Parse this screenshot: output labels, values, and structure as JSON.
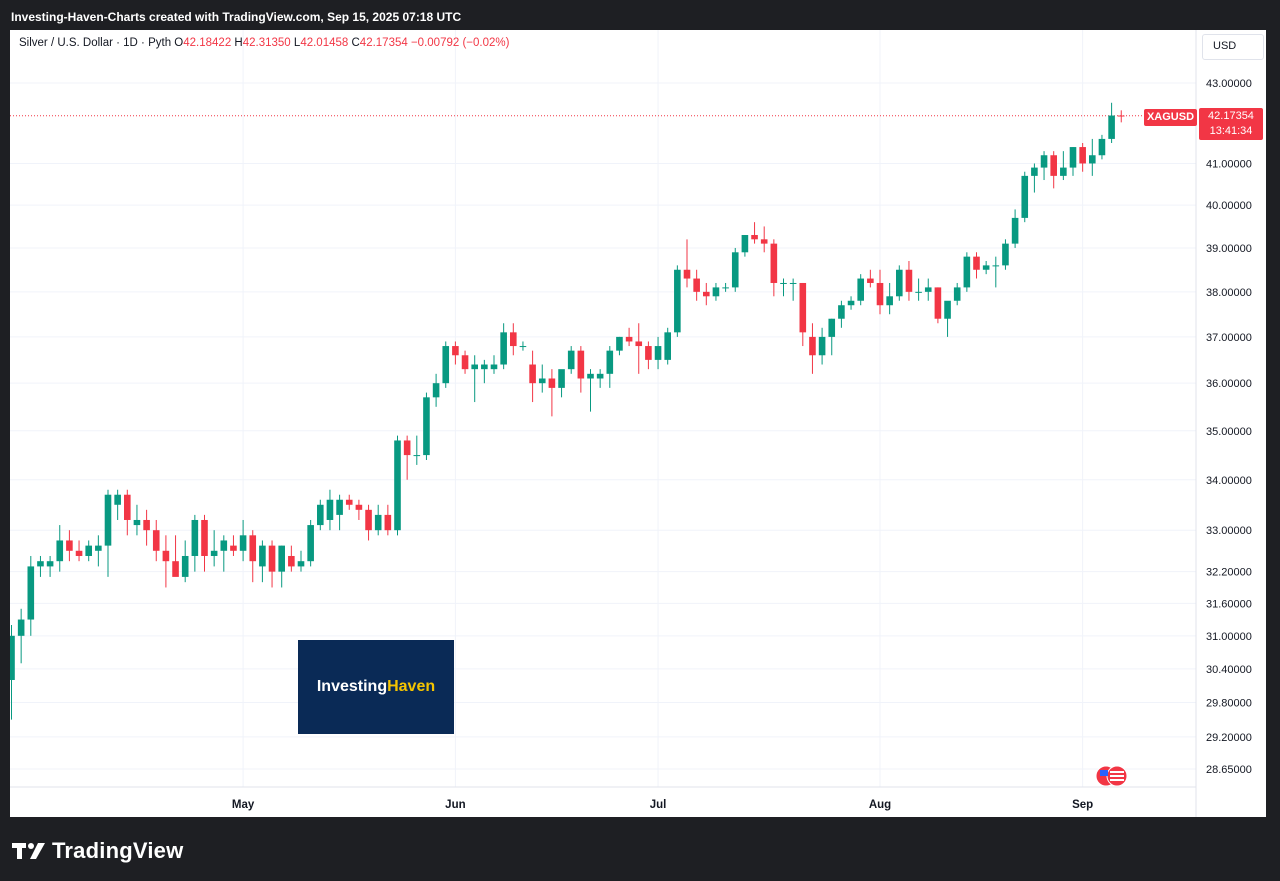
{
  "header": {
    "caption": "Investing-Haven-Charts created with TradingView.com, Sep 15, 2025 07:18 UTC"
  },
  "legend": {
    "symbol": "Silver / U.S. Dollar · 1D · Pyth",
    "open_label": "O",
    "open": "42.18422",
    "high_label": "H",
    "high": "42.31350",
    "low_label": "L",
    "low": "42.01458",
    "close_label": "C",
    "close": "42.17354",
    "change": "−0.00792 (−0.02%)"
  },
  "currency_button": "USD",
  "price_marker": {
    "ticker": "XAGUSD",
    "price": "42.17354",
    "countdown": "13:41:34"
  },
  "watermark": {
    "part1": "Investing",
    "part2": "Haven"
  },
  "footer": {
    "brand": "TradingView"
  },
  "colors": {
    "up": "#089981",
    "down": "#f23645",
    "grid": "#f0f3fa",
    "text": "#131722"
  },
  "chart_data": {
    "type": "candlestick",
    "scale": "log",
    "y_ticks": [
      "43.00000",
      "41.00000",
      "40.00000",
      "39.00000",
      "38.00000",
      "37.00000",
      "36.00000",
      "35.00000",
      "34.00000",
      "33.00000",
      "32.20000",
      "31.60000",
      "31.00000",
      "30.40000",
      "29.80000",
      "29.20000",
      "28.65000"
    ],
    "x_ticks": [
      {
        "label": "May",
        "index": 24
      },
      {
        "label": "Jun",
        "index": 46
      },
      {
        "label": "Jul",
        "index": 67
      },
      {
        "label": "Aug",
        "index": 90
      },
      {
        "label": "Sep",
        "index": 111
      }
    ],
    "last_price": 42.17354,
    "candles": [
      [
        30.2,
        31.2,
        29.5,
        31.0
      ],
      [
        31.0,
        31.5,
        30.5,
        31.3
      ],
      [
        31.3,
        32.5,
        31.0,
        32.3
      ],
      [
        32.3,
        32.5,
        32.1,
        32.4
      ],
      [
        32.3,
        32.5,
        32.1,
        32.4
      ],
      [
        32.4,
        33.1,
        32.2,
        32.8
      ],
      [
        32.8,
        33.0,
        32.4,
        32.6
      ],
      [
        32.6,
        32.8,
        32.4,
        32.5
      ],
      [
        32.5,
        32.8,
        32.4,
        32.7
      ],
      [
        32.6,
        32.9,
        32.3,
        32.7
      ],
      [
        32.7,
        33.8,
        32.1,
        33.7
      ],
      [
        33.5,
        33.8,
        33.2,
        33.7
      ],
      [
        33.7,
        33.8,
        32.9,
        33.2
      ],
      [
        33.1,
        33.5,
        32.9,
        33.2
      ],
      [
        33.2,
        33.4,
        32.7,
        33.0
      ],
      [
        33.0,
        33.2,
        32.4,
        32.6
      ],
      [
        32.6,
        32.9,
        31.9,
        32.4
      ],
      [
        32.4,
        32.9,
        32.2,
        32.1
      ],
      [
        32.1,
        32.8,
        32.0,
        32.5
      ],
      [
        32.5,
        33.3,
        32.2,
        33.2
      ],
      [
        33.2,
        33.3,
        32.2,
        32.5
      ],
      [
        32.5,
        33.0,
        32.3,
        32.6
      ],
      [
        32.6,
        32.9,
        32.2,
        32.8
      ],
      [
        32.7,
        32.9,
        32.5,
        32.6
      ],
      [
        32.6,
        33.2,
        32.4,
        32.9
      ],
      [
        32.9,
        33.0,
        32.0,
        32.4
      ],
      [
        32.3,
        32.8,
        32.0,
        32.7
      ],
      [
        32.7,
        32.8,
        31.9,
        32.2
      ],
      [
        32.2,
        32.7,
        31.9,
        32.7
      ],
      [
        32.5,
        32.7,
        32.2,
        32.3
      ],
      [
        32.3,
        32.6,
        32.2,
        32.4
      ],
      [
        32.4,
        33.2,
        32.3,
        33.1
      ],
      [
        33.1,
        33.6,
        33.0,
        33.5
      ],
      [
        33.2,
        33.8,
        33.0,
        33.6
      ],
      [
        33.3,
        33.7,
        33.0,
        33.6
      ],
      [
        33.6,
        33.7,
        33.4,
        33.5
      ],
      [
        33.5,
        33.6,
        33.2,
        33.4
      ],
      [
        33.4,
        33.5,
        32.8,
        33.0
      ],
      [
        33.0,
        33.5,
        32.9,
        33.3
      ],
      [
        33.3,
        33.5,
        32.9,
        33.0
      ],
      [
        33.0,
        34.9,
        32.9,
        34.8
      ],
      [
        34.8,
        34.9,
        34.0,
        34.5
      ],
      [
        34.5,
        34.9,
        34.3,
        34.5
      ],
      [
        34.5,
        35.8,
        34.4,
        35.7
      ],
      [
        35.7,
        36.2,
        35.5,
        36.0
      ],
      [
        36.0,
        36.9,
        35.9,
        36.8
      ],
      [
        36.8,
        36.9,
        36.4,
        36.6
      ],
      [
        36.6,
        36.7,
        36.2,
        36.3
      ],
      [
        36.3,
        36.6,
        35.6,
        36.4
      ],
      [
        36.3,
        36.5,
        36.0,
        36.4
      ],
      [
        36.3,
        36.6,
        36.2,
        36.4
      ],
      [
        36.4,
        37.3,
        36.3,
        37.1
      ],
      [
        37.1,
        37.3,
        36.6,
        36.8
      ],
      [
        36.8,
        36.9,
        36.7,
        36.8
      ],
      [
        36.4,
        36.7,
        35.6,
        36.0
      ],
      [
        36.0,
        36.4,
        35.8,
        36.1
      ],
      [
        36.1,
        36.3,
        35.3,
        35.9
      ],
      [
        35.9,
        36.2,
        35.7,
        36.3
      ],
      [
        36.3,
        36.8,
        36.2,
        36.7
      ],
      [
        36.7,
        36.8,
        35.8,
        36.1
      ],
      [
        36.1,
        36.3,
        35.4,
        36.2
      ],
      [
        36.1,
        36.3,
        35.9,
        36.2
      ],
      [
        36.2,
        36.8,
        35.9,
        36.7
      ],
      [
        36.7,
        37.0,
        36.6,
        37.0
      ],
      [
        37.0,
        37.2,
        36.8,
        36.9
      ],
      [
        36.9,
        37.3,
        36.2,
        36.8
      ],
      [
        36.8,
        36.9,
        36.3,
        36.5
      ],
      [
        36.5,
        37.0,
        36.3,
        36.8
      ],
      [
        36.5,
        37.2,
        36.4,
        37.1
      ],
      [
        37.1,
        38.6,
        37.0,
        38.5
      ],
      [
        38.5,
        39.2,
        38.1,
        38.3
      ],
      [
        38.3,
        38.5,
        37.8,
        38.0
      ],
      [
        38.0,
        38.2,
        37.7,
        37.9
      ],
      [
        37.9,
        38.2,
        37.8,
        38.1
      ],
      [
        38.1,
        38.2,
        38.0,
        38.1
      ],
      [
        38.1,
        39.0,
        38.0,
        38.9
      ],
      [
        38.9,
        39.3,
        38.8,
        39.3
      ],
      [
        39.3,
        39.6,
        39.1,
        39.2
      ],
      [
        39.2,
        39.5,
        38.9,
        39.1
      ],
      [
        39.1,
        39.2,
        37.9,
        38.2
      ],
      [
        38.2,
        38.3,
        37.9,
        38.2
      ],
      [
        38.2,
        38.3,
        37.8,
        38.2
      ],
      [
        38.2,
        38.2,
        36.8,
        37.1
      ],
      [
        37.0,
        37.3,
        36.2,
        36.6
      ],
      [
        36.6,
        37.2,
        36.4,
        37.0
      ],
      [
        37.0,
        37.4,
        36.6,
        37.4
      ],
      [
        37.4,
        37.8,
        37.2,
        37.7
      ],
      [
        37.7,
        37.9,
        37.6,
        37.8
      ],
      [
        37.8,
        38.4,
        37.7,
        38.3
      ],
      [
        38.3,
        38.5,
        38.1,
        38.2
      ],
      [
        38.2,
        38.5,
        37.5,
        37.7
      ],
      [
        37.7,
        38.2,
        37.5,
        37.9
      ],
      [
        37.9,
        38.6,
        37.8,
        38.5
      ],
      [
        38.5,
        38.7,
        37.8,
        38.0
      ],
      [
        38.0,
        38.3,
        37.8,
        38.0
      ],
      [
        38.0,
        38.3,
        37.8,
        38.1
      ],
      [
        38.1,
        38.1,
        37.3,
        37.4
      ],
      [
        37.4,
        37.7,
        37.0,
        37.8
      ],
      [
        37.8,
        38.2,
        37.7,
        38.1
      ],
      [
        38.1,
        38.9,
        38.0,
        38.8
      ],
      [
        38.8,
        38.9,
        38.3,
        38.5
      ],
      [
        38.5,
        38.7,
        38.4,
        38.6
      ],
      [
        38.6,
        38.8,
        38.1,
        38.6
      ],
      [
        38.6,
        39.2,
        38.5,
        39.1
      ],
      [
        39.1,
        39.9,
        39.0,
        39.7
      ],
      [
        39.7,
        40.8,
        39.6,
        40.7
      ],
      [
        40.7,
        41.0,
        40.3,
        40.9
      ],
      [
        40.9,
        41.3,
        40.6,
        41.2
      ],
      [
        41.2,
        41.3,
        40.4,
        40.7
      ],
      [
        40.7,
        41.3,
        40.6,
        40.9
      ],
      [
        40.9,
        41.4,
        40.7,
        41.4
      ],
      [
        41.4,
        41.5,
        40.8,
        41.0
      ],
      [
        41.0,
        41.6,
        40.7,
        41.2
      ],
      [
        41.2,
        41.7,
        41.1,
        41.6
      ],
      [
        41.6,
        42.5,
        41.5,
        42.18
      ],
      [
        42.18,
        42.31,
        42.01,
        42.17
      ]
    ]
  }
}
